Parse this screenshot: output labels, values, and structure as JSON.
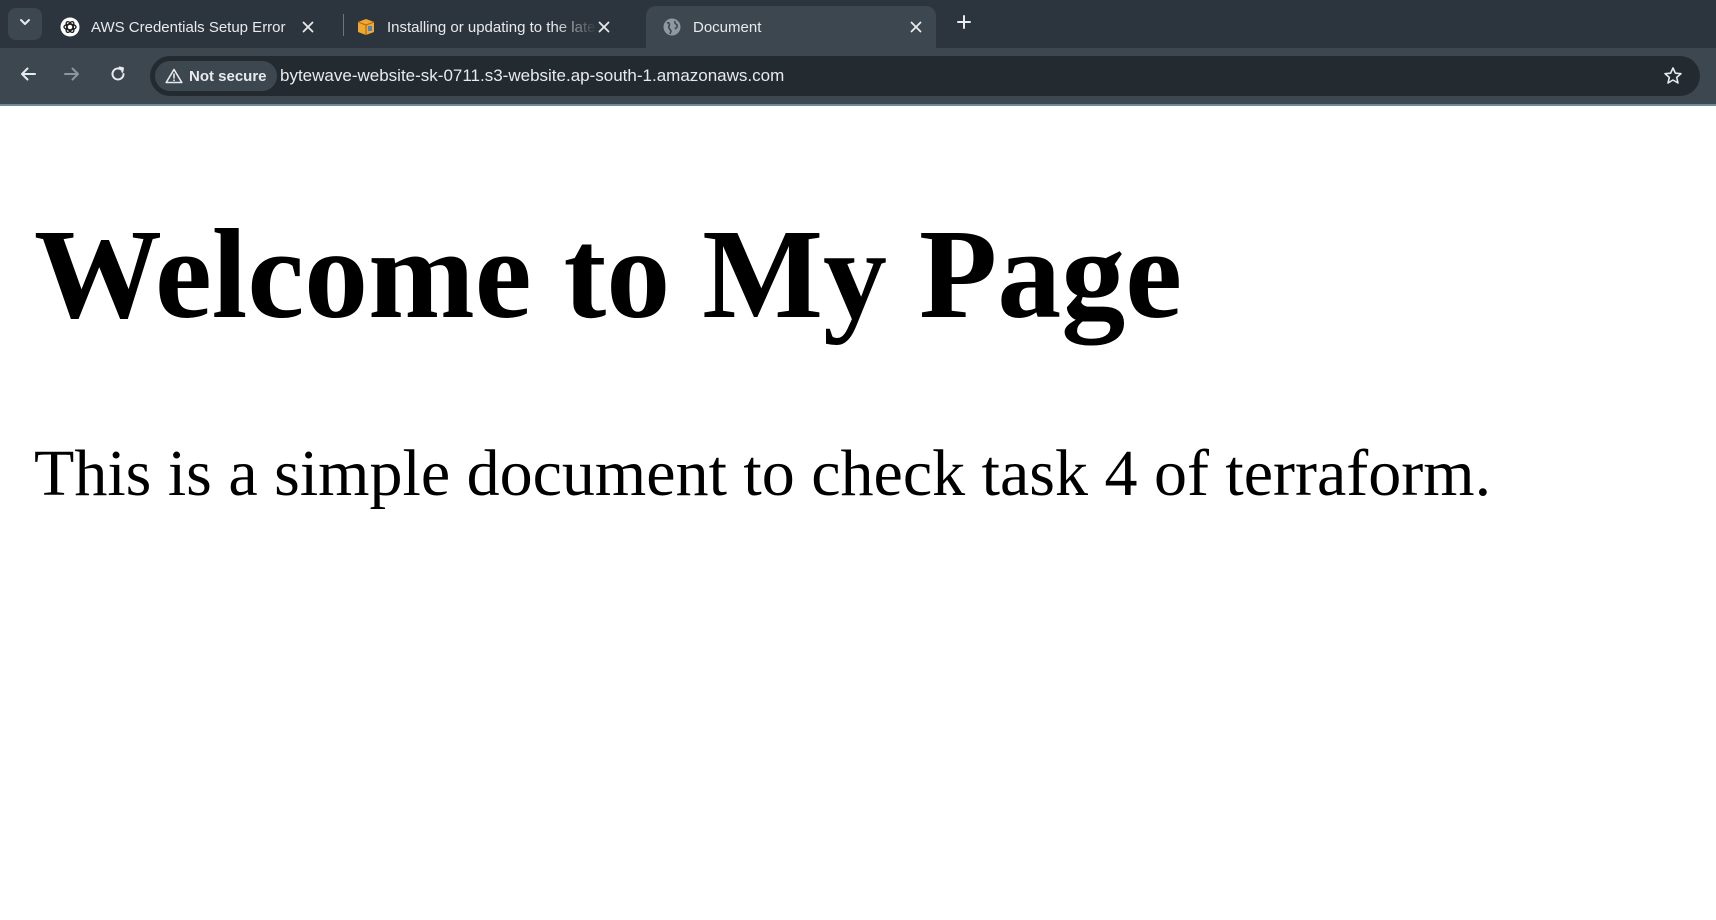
{
  "tabs": [
    {
      "title": "AWS Credentials Setup Error",
      "favicon": "openai-icon",
      "active": false
    },
    {
      "title": "Installing or updating to the latest version of the AWS CLI",
      "favicon": "aws-cli-icon",
      "active": false
    },
    {
      "title": "Document",
      "favicon": "globe-icon",
      "active": true
    }
  ],
  "toolbar": {
    "security_label": "Not secure",
    "url": "bytewave-website-sk-0711.s3-website.ap-south-1.amazonaws.com"
  },
  "page": {
    "heading": "Welcome to My Page",
    "paragraph": "This is a simple document to check task 4 of terraform."
  },
  "colors": {
    "tabstrip_bg": "#2c353d",
    "toolbar_bg": "#3c4750",
    "omnibox_bg": "#232b31",
    "text_light": "#e8eaed",
    "aws_orange": "#f0a830"
  }
}
